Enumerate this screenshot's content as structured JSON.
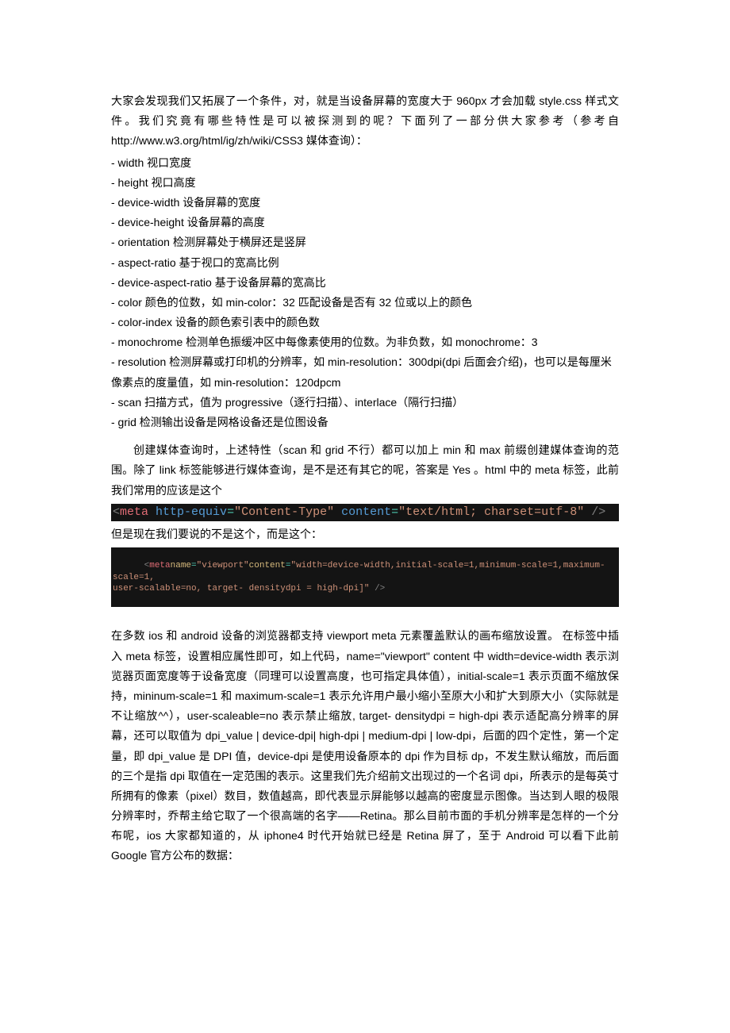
{
  "intro": "大家会发现我们又拓展了一个条件，对，就是当设备屏幕的宽度大于 960px 才会加载 style.css 样式文件。我们究竟有哪些特性是可以被探测到的呢？下面列了一部分供大家参考（参考自 http://www.w3.org/html/ig/zh/wiki/CSS3 媒体查询）：",
  "features": [
    "- width  视口宽度",
    "- height  视口高度",
    "- device-width  设备屏幕的宽度",
    "- device-height  设备屏幕的高度",
    "- orientation  检测屏幕处于横屏还是竖屏",
    "- aspect-ratio  基于视口的宽高比例",
    "- device-aspect-ratio  基于设备屏幕的宽高比",
    "- color  颜色的位数，如 min-color：32  匹配设备是否有 32 位或以上的颜色",
    "- color-index  设备的颜色索引表中的颜色数",
    "- monochrome  检测单色振缓冲区中每像素使用的位数。为非负数，如 monochrome：3",
    "- resolution  检测屏幕或打印机的分辨率，如 min-resolution：300dpi(dpi 后面会介绍)，也可以是每厘米像素点的度量值，如 min-resolution：120dpcm",
    "- scan  扫描方式，值为 progressive（逐行扫描）、interlace（隔行扫描）",
    "- grid  检测输出设备是网格设备还是位图设备"
  ],
  "para2": "创建媒体查询时，上述特性（scan 和 grid 不行）都可以加上 min 和 max 前缀创建媒体查询的范围。除了 link 标签能够进行媒体查询，是不是还有其它的呢，答案是 Yes 。html 中的 meta 标签，此前我们常用的应该是这个",
  "code1": {
    "lt": "<",
    "tag": "meta",
    "sp1": " ",
    "attr1": "http-equiv",
    "eq1": "=",
    "val1": "\"Content-Type\"",
    "sp2": " ",
    "attr2": "content",
    "eq2": "=",
    "val2": "\"text/html; charset=utf-8\"",
    "sp3": " ",
    "close": "/>"
  },
  "para3": "但是现在我们要说的不是这个，而是这个：",
  "code2": {
    "lt": "<",
    "tag": "meta",
    "attr1": "name",
    "eq1": "=",
    "val1": "\"viewport\"",
    "attr2": "content",
    "eq2": "=",
    "val2a": "\"width=device-width,initial-scale=1,minimum-scale=1,maximum-scale=1,",
    "val2b": "user-scalable=no, target- densitydpi = high-dpi]\"",
    "sp": " ",
    "close": "/>"
  },
  "para4": "在多数 ios 和 android 设备的浏览器都支持 viewport meta 元素覆盖默认的画布缩放设置。 在标签中插入 meta 标签，设置相应属性即可，如上代码，name=\"viewport\" content 中 width=device-width 表示浏览器页面宽度等于设备宽度（同理可以设置高度，也可指定具体值），initial-scale=1 表示页面不缩放保持，mininum-scale=1 和 maximum-scale=1 表示允许用户最小缩小至原大小和扩大到原大小（实际就是不让缩放^^），user-scaleable=no 表示禁止缩放, target- densitydpi = high-dpi 表示适配高分辨率的屏幕，还可以取值为 dpi_value | device-dpi| high-dpi | medium-dpi | low-dpi，后面的四个定性，第一个定量，即 dpi_value 是 DPI 值，device-dpi 是使用设备原本的  dpi  作为目标  dp，不发生默认缩放，而后面的三个是指 dpi 取值在一定范围的表示。这里我们先介绍前文出现过的一个名词 dpi，所表示的是每英寸所拥有的像素（pixel）数目，数值越高，即代表显示屏能够以越高的密度显示图像。当达到人眼的极限分辨率时，乔帮主给它取了一个很高端的名字——Retina。那么目前市面的手机分辨率是怎样的一个分布呢，ios 大家都知道的，从 iphone4 时代开始就已经是 Retina 屏了，至于 Android 可以看下此前 Google 官方公布的数据："
}
